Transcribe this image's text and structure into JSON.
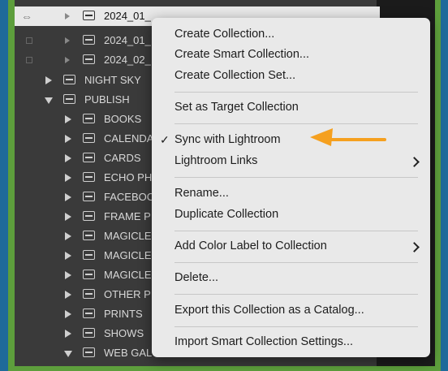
{
  "tree": {
    "rows": [
      {
        "label": "2024_01_"
      },
      {
        "label": "2024_01_"
      },
      {
        "label": "2024_02_"
      },
      {
        "label": "NIGHT SKY"
      },
      {
        "label": "PUBLISH"
      },
      {
        "label": "BOOKS"
      },
      {
        "label": "CALENDA"
      },
      {
        "label": "CARDS"
      },
      {
        "label": "ECHO PH"
      },
      {
        "label": "FACEBOC"
      },
      {
        "label": "FRAME P"
      },
      {
        "label": "MAGICLE"
      },
      {
        "label": "MAGICLE"
      },
      {
        "label": "MAGICLE"
      },
      {
        "label": "OTHER P"
      },
      {
        "label": "PRINTS"
      },
      {
        "label": "SHOWS"
      },
      {
        "label": "WEB GAL"
      }
    ]
  },
  "menu": {
    "create_collection": "Create Collection...",
    "create_smart_collection": "Create Smart Collection...",
    "create_collection_set": "Create Collection Set...",
    "set_as_target": "Set as Target Collection",
    "sync_with_lightroom": "Sync with Lightroom",
    "sync_checkmark": "✓",
    "lightroom_links": "Lightroom Links",
    "rename": "Rename...",
    "duplicate": "Duplicate Collection",
    "add_color_label": "Add Color Label to Collection",
    "delete": "Delete...",
    "export_catalog": "Export this Collection as a Catalog...",
    "import_smart_settings": "Import Smart Collection Settings..."
  },
  "annotation": {
    "arrow_color": "#f5a01f"
  }
}
